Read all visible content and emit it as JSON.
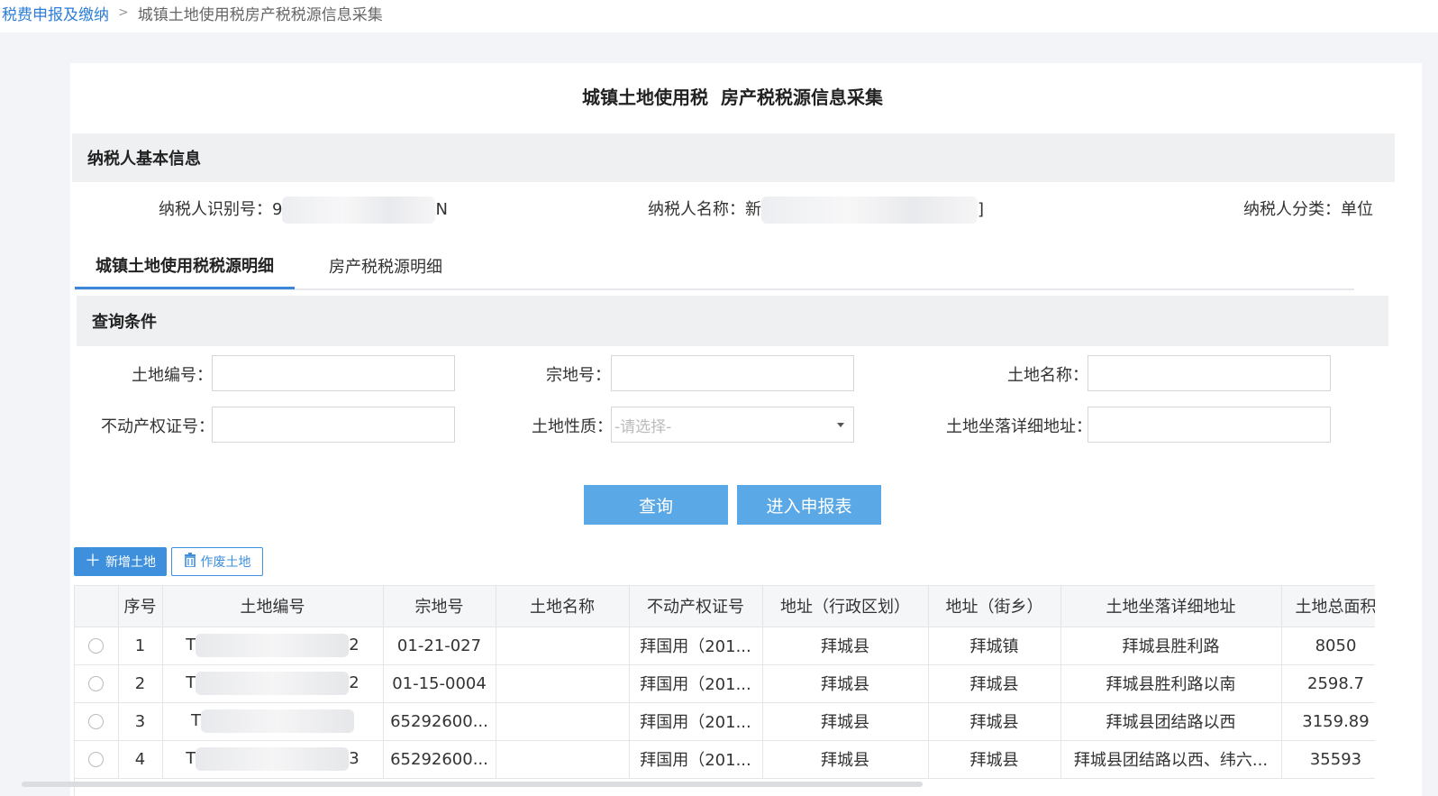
{
  "breadcrumb": {
    "link": "税费申报及缴纳",
    "separator": ">",
    "current": "城镇土地使用税房产税税源信息采集"
  },
  "page_title": "城镇土地使用税  房产税税源信息采集",
  "taxpayer_section": {
    "title": "纳税人基本信息",
    "id_label": "纳税人识别号：",
    "id_prefix": "9",
    "id_suffix": "N",
    "name_label": "纳税人名称：",
    "name_prefix": "新",
    "name_suffix": "]",
    "category_label": "纳税人分类：",
    "category_value": "单位"
  },
  "tabs": [
    {
      "label": "城镇土地使用税税源明细",
      "active": true
    },
    {
      "label": "房产税税源明细",
      "active": false
    }
  ],
  "query": {
    "title": "查询条件",
    "land_no_label": "土地编号：",
    "lot_no_label": "宗地号：",
    "land_name_label": "土地名称：",
    "cert_no_label": "不动产权证号：",
    "land_nature_label": "土地性质：",
    "land_nature_placeholder": "-请选择-",
    "address_label": "土地坐落详细地址：",
    "search_button": "查询",
    "report_button": "进入申报表"
  },
  "toolbar": {
    "add_label": "新增土地",
    "void_label": "作废土地",
    "add_icon": "plus-icon",
    "void_icon": "trash-icon"
  },
  "table": {
    "headers": [
      "",
      "序号",
      "土地编号",
      "宗地号",
      "土地名称",
      "不动产权证号",
      "地址（行政区划）",
      "地址（街乡）",
      "土地坐落详细地址",
      "土地总面积"
    ],
    "rows": [
      {
        "seq": "1",
        "land_no_prefix": "T",
        "land_no_suffix": "2",
        "lot_no": "01-21-027",
        "name": "",
        "cert": "拜国用（201...",
        "district": "拜城县",
        "street": "拜城镇",
        "address": "拜城县胜利路",
        "area": "8050"
      },
      {
        "seq": "2",
        "land_no_prefix": "T",
        "land_no_suffix": "2",
        "lot_no": "01-15-0004",
        "name": "",
        "cert": "拜国用（201...",
        "district": "拜城县",
        "street": "拜城县",
        "address": "拜城县胜利路以南",
        "area": "2598.7"
      },
      {
        "seq": "3",
        "land_no_prefix": "T",
        "land_no_suffix": "",
        "lot_no": "65292600...",
        "name": "",
        "cert": "拜国用（201...",
        "district": "拜城县",
        "street": "拜城县",
        "address": "拜城县团结路以西",
        "area": "3159.89"
      },
      {
        "seq": "4",
        "land_no_prefix": "T",
        "land_no_suffix": "3",
        "lot_no": "65292600...",
        "name": "",
        "cert": "拜国用（201...",
        "district": "拜城县",
        "street": "拜城县",
        "address": "拜城县团结路以西、纬六...",
        "area": "35593"
      }
    ]
  },
  "colors": {
    "accent": "#3e8fdc",
    "primary_button": "#5aa9e6",
    "link": "#2d7ed6",
    "section_bg": "#eef0f2"
  }
}
